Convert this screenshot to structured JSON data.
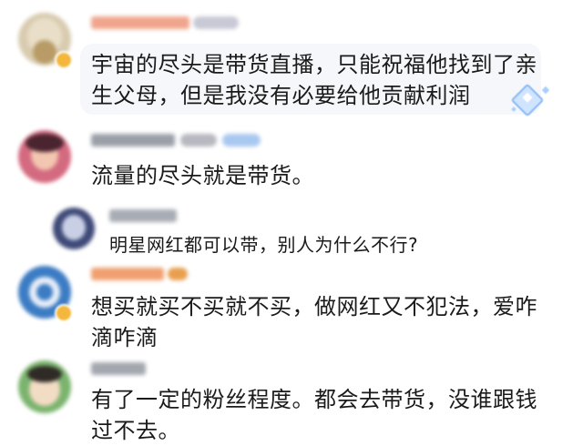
{
  "comments": [
    {
      "text_line1": "宇宙的尽头是带货直播，只能祝福他找到了亲",
      "text_line2": "生父母，但是我没有必要给他贡献利润"
    },
    {
      "text_line1": "流量的尽头就是带货。"
    },
    {
      "text_line1": "明星网红都可以带，别人为什么不行?"
    },
    {
      "text_line1": "想买就买不买就不买，做网红又不犯法，爱咋",
      "text_line2": "滴咋滴"
    },
    {
      "text_line1": "有了一定的粉丝程度。都会去带货，没谁跟钱",
      "text_line2": "过不去。"
    }
  ],
  "icons": {
    "sticker": "diamond-sticker-icon",
    "verified": "verified-badge-icon"
  },
  "colors": {
    "text": "#1a1a1a",
    "bubble": "#f5f7fb",
    "sticker_blue": "#8ab8f5",
    "badge_gold": "#f4b73b"
  }
}
